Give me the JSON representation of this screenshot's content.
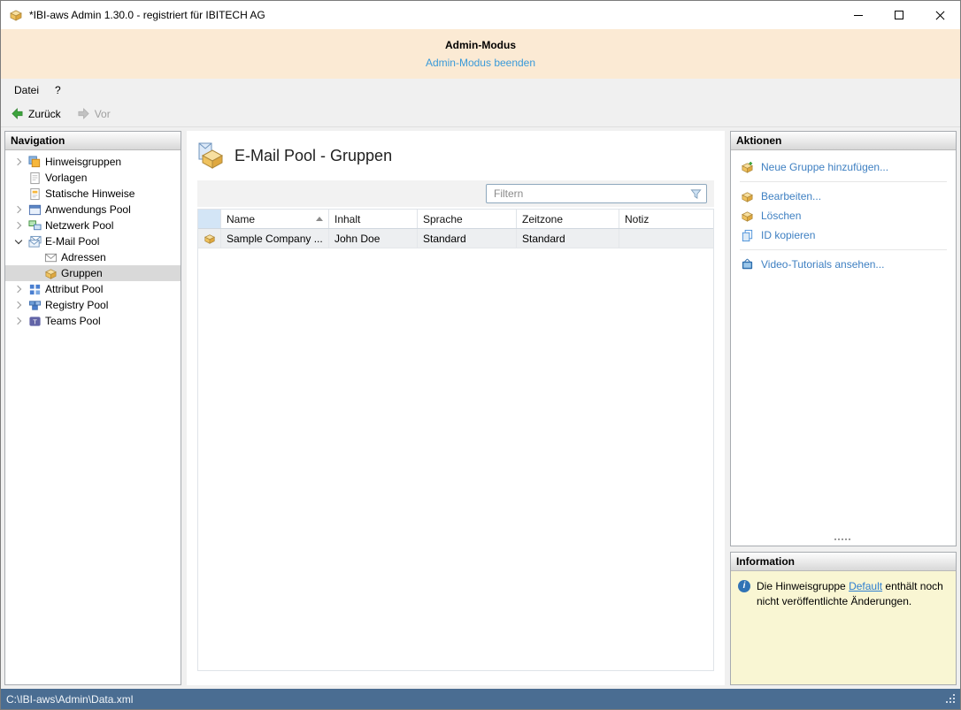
{
  "window": {
    "title": "*IBI-aws Admin 1.30.0 - registriert für IBITECH AG"
  },
  "admin_banner": {
    "title": "Admin-Modus",
    "link": "Admin-Modus beenden"
  },
  "menu": {
    "items": [
      {
        "label": "Datei"
      },
      {
        "label": "?"
      }
    ]
  },
  "toolbar": {
    "back": "Zurück",
    "forward": "Vor"
  },
  "navigation": {
    "header": "Navigation",
    "items": [
      {
        "label": "Hinweisgruppen",
        "icon": "hint-groups-icon",
        "expander": "collapsed",
        "level": 0
      },
      {
        "label": "Vorlagen",
        "icon": "templates-icon",
        "expander": "none",
        "level": 0
      },
      {
        "label": "Statische Hinweise",
        "icon": "static-hints-icon",
        "expander": "none",
        "level": 0
      },
      {
        "label": "Anwendungs Pool",
        "icon": "application-pool-icon",
        "expander": "collapsed",
        "level": 0
      },
      {
        "label": "Netzwerk Pool",
        "icon": "network-pool-icon",
        "expander": "collapsed",
        "level": 0
      },
      {
        "label": "E-Mail Pool",
        "icon": "email-pool-icon",
        "expander": "expanded",
        "level": 0
      },
      {
        "label": "Adressen",
        "icon": "addresses-icon",
        "expander": "none",
        "level": 1
      },
      {
        "label": "Gruppen",
        "icon": "groups-icon",
        "expander": "none",
        "level": 1,
        "selected": true
      },
      {
        "label": "Attribut Pool",
        "icon": "attribute-pool-icon",
        "expander": "collapsed",
        "level": 0
      },
      {
        "label": "Registry Pool",
        "icon": "registry-pool-icon",
        "expander": "collapsed",
        "level": 0
      },
      {
        "label": "Teams Pool",
        "icon": "teams-pool-icon",
        "expander": "collapsed",
        "level": 0
      }
    ]
  },
  "main": {
    "title": "E-Mail Pool - Gruppen",
    "title_icon": "email-group-box-icon",
    "filter_placeholder": "Filtern",
    "filter_icon": "filter-funnel-icon",
    "table": {
      "columns": [
        "Name",
        "Inhalt",
        "Sprache",
        "Zeitzone",
        "Notiz"
      ],
      "sorted_column": "Name",
      "sort_direction": "asc",
      "rows": [
        {
          "icon": "group-box-icon",
          "name": "Sample Company ...",
          "inhalt": "John Doe",
          "sprache": "Standard",
          "zeitzone": "Standard",
          "notiz": ""
        }
      ]
    }
  },
  "actions": {
    "header": "Aktionen",
    "items": [
      {
        "label": "Neue Gruppe hinzufügen...",
        "icon": "add-group-icon"
      },
      {
        "label": "Bearbeiten...",
        "icon": "edit-group-icon"
      },
      {
        "label": "Löschen",
        "icon": "delete-group-icon"
      },
      {
        "label": "ID kopieren",
        "icon": "copy-id-icon"
      },
      {
        "label": "Video-Tutorials ansehen...",
        "icon": "video-tutorials-icon"
      }
    ]
  },
  "information": {
    "header": "Information",
    "icon": "info-icon",
    "text_before": "Die Hinweisgruppe ",
    "link": "Default",
    "text_after": " enthält noch nicht veröffentlichte Änderungen."
  },
  "status_bar": {
    "path": "C:\\IBI-aws\\Admin\\Data.xml"
  },
  "colors": {
    "accent_link": "#3f80c2",
    "banner_bg": "#fbead4",
    "banner_link": "#3a9ad9",
    "info_bg": "#f9f6d3",
    "statusbar_bg": "#4a6d92",
    "selection_bg": "#d9d9d9"
  }
}
